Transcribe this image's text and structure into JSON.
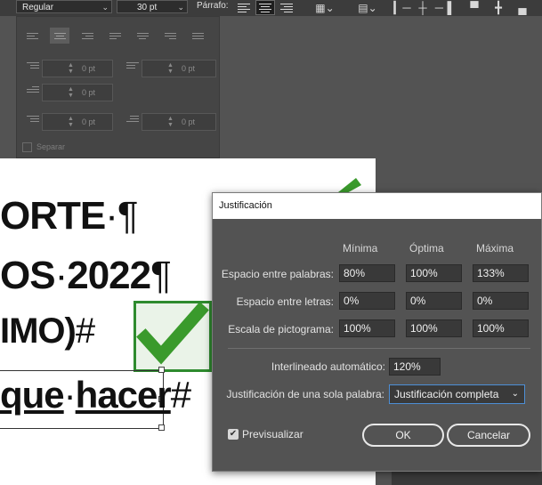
{
  "toolbar": {
    "font_style": "Regular",
    "font_size": "30 pt",
    "parrafo_label": "Párrafo:"
  },
  "paragraph_panel": {
    "field_values": [
      "0 pt",
      "0 pt",
      "0 pt",
      "0 pt",
      "0 pt",
      "0 pt"
    ],
    "separar_label": "Separar"
  },
  "document": {
    "lines": [
      {
        "text": "ORTE",
        "mark": "·¶"
      },
      {
        "text": "OS",
        "mark": "·",
        "text2": "2022",
        "mark2": "¶"
      },
      {
        "text": "IMO)",
        "mark": "#"
      },
      {
        "text": "que",
        "mark": "·",
        "text2": "hacer",
        "mark2": "#"
      }
    ]
  },
  "dialog": {
    "title": "Justificación",
    "col_headers": [
      "Mínima",
      "Óptima",
      "Máxima"
    ],
    "rows": [
      {
        "label": "Espacio entre palabras:",
        "values": [
          "80%",
          "100%",
          "133%"
        ]
      },
      {
        "label": "Espacio entre letras:",
        "values": [
          "0%",
          "0%",
          "0%"
        ]
      },
      {
        "label": "Escala de pictograma:",
        "values": [
          "100%",
          "100%",
          "100%"
        ]
      }
    ],
    "auto_leading_label": "Interlineado automático:",
    "auto_leading_value": "120%",
    "single_word_label": "Justificación de una sola palabra:",
    "single_word_value": "Justificación completa",
    "preview_label": "Previsualizar",
    "preview_checked": true,
    "ok_label": "OK",
    "cancel_label": "Cancelar"
  }
}
